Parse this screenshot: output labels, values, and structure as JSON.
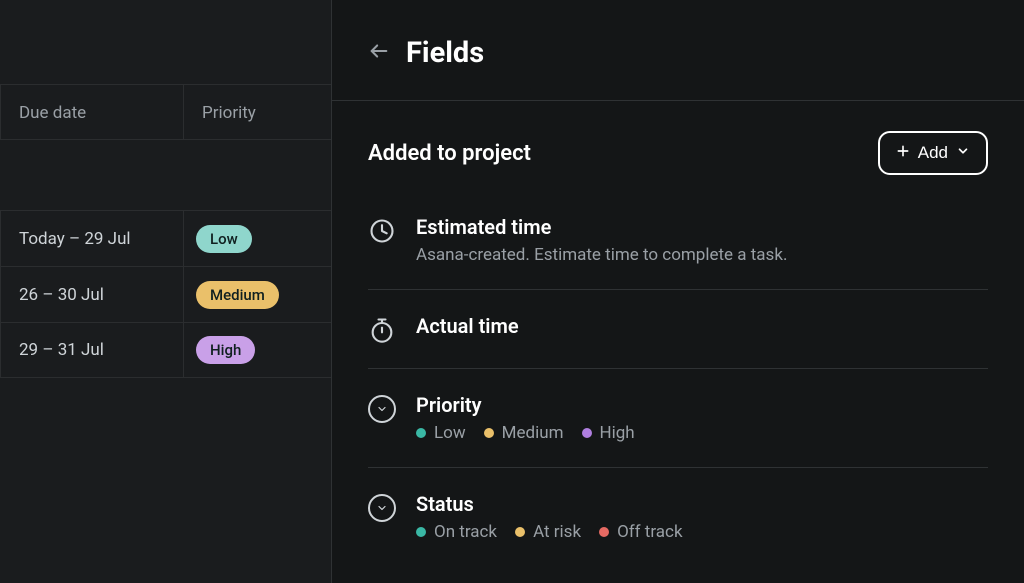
{
  "left_table": {
    "headers": {
      "date": "Due date",
      "priority": "Priority"
    },
    "rows": [
      {
        "date": "Today – 29 Jul",
        "priority": {
          "label": "Low",
          "level": "low"
        }
      },
      {
        "date": "26 – 30 Jul",
        "priority": {
          "label": "Medium",
          "level": "med"
        }
      },
      {
        "date": "29 – 31 Jul",
        "priority": {
          "label": "High",
          "level": "high"
        }
      }
    ]
  },
  "panel": {
    "title": "Fields",
    "section_title": "Added to project",
    "add_button_label": "Add",
    "fields": [
      {
        "icon": "clock-icon",
        "name": "Estimated time",
        "description": "Asana-created. Estimate time to complete a task."
      },
      {
        "icon": "stopwatch-icon",
        "name": "Actual time"
      },
      {
        "icon": "chevron-circle-icon",
        "name": "Priority",
        "options": [
          {
            "label": "Low",
            "color": "#3ab8a5"
          },
          {
            "label": "Medium",
            "color": "#eac06a"
          },
          {
            "label": "High",
            "color": "#b07fe0"
          }
        ]
      },
      {
        "icon": "chevron-circle-icon",
        "name": "Status",
        "options": [
          {
            "label": "On track",
            "color": "#3ab8a5"
          },
          {
            "label": "At risk",
            "color": "#eac06a"
          },
          {
            "label": "Off track",
            "color": "#e66a63"
          }
        ]
      }
    ]
  }
}
